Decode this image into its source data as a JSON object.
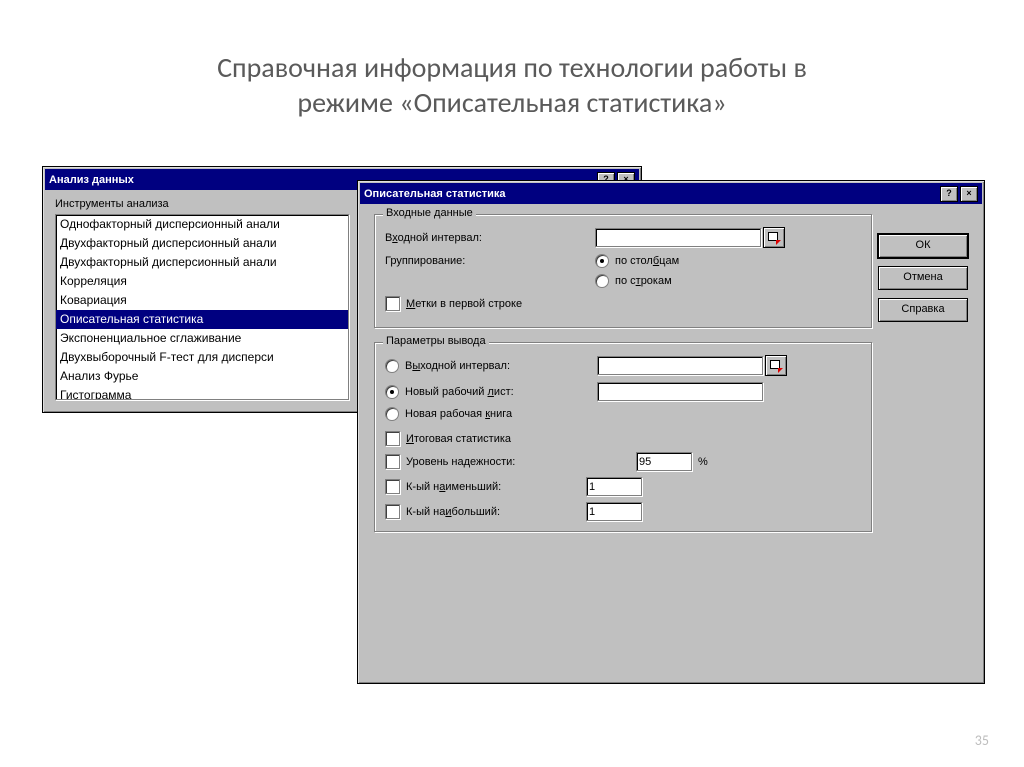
{
  "slide": {
    "title_line1": "Справочная информация по технологии работы в",
    "title_line2": "режиме «Описательная статистика»",
    "page_number": "35"
  },
  "dialog_analysis": {
    "title": "Анализ данных",
    "tools_label": "Инструменты анализа",
    "items": [
      "Однофакторный дисперсионный анали",
      "Двухфакторный дисперсионный анали",
      "Двухфакторный дисперсионный анали",
      "Корреляция",
      "Ковариация",
      "Описательная статистика",
      "Экспоненциальное сглаживание",
      "Двухвыборочный F-тест для дисперси",
      "Анализ Фурье",
      "Гистограмма"
    ],
    "selected_index": 5
  },
  "dialog_descstat": {
    "title": "Описательная статистика",
    "buttons": {
      "ok": "ОК",
      "cancel": "Отмена",
      "help": "Справка"
    },
    "group_input_legend": "Входные данные",
    "input_range_label": "Входной интервал:",
    "input_range_value": "",
    "grouping_label": "Группирование:",
    "grouping_by_columns": "по столбцам",
    "grouping_by_rows": "по строкам",
    "grouping_selected": "columns",
    "labels_first_row": "Метки в первой строке",
    "group_output_legend": "Параметры вывода",
    "out_range_label": "Выходной интервал:",
    "out_range_value": "",
    "out_new_sheet_label": "Новый рабочий лист:",
    "out_new_sheet_value": "",
    "out_new_book_label": "Новая рабочая книга",
    "output_selected": "new_sheet",
    "summary_stats_label": "Итоговая статистика",
    "confidence_label": "Уровень надежности:",
    "confidence_value": "95",
    "confidence_unit": "%",
    "kth_smallest_label": "К-ый наименьший:",
    "kth_smallest_value": "1",
    "kth_largest_label": "К-ый наибольший:",
    "kth_largest_value": "1"
  }
}
